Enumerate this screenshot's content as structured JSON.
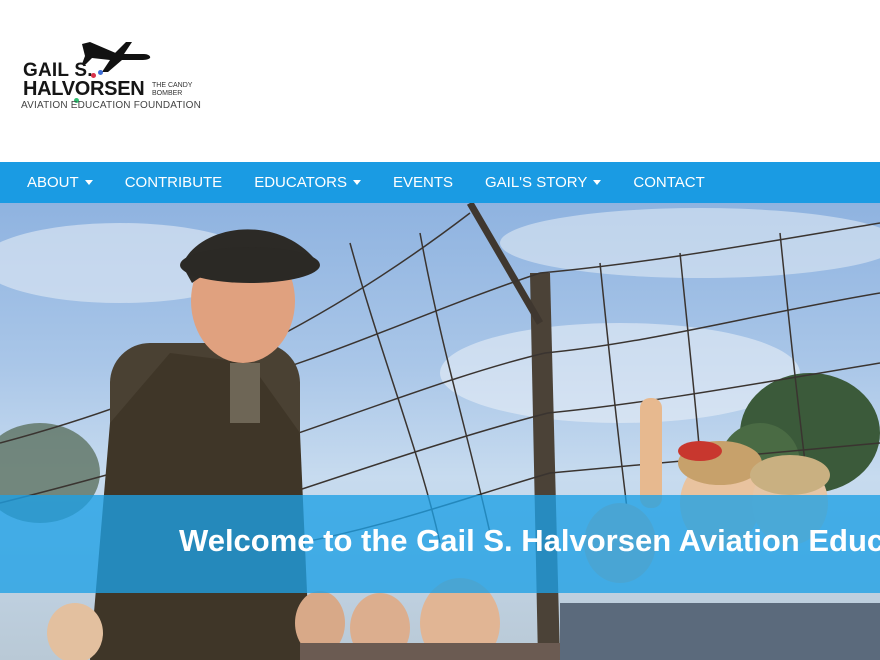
{
  "logo": {
    "line1": "GAIL S.",
    "line2": "HALVORSEN",
    "tagline": "THE CANDY BOMBER",
    "foundation": "AVIATION EDUCATION FOUNDATION"
  },
  "nav": {
    "items": [
      {
        "label": "ABOUT",
        "has_dropdown": true
      },
      {
        "label": "CONTRIBUTE",
        "has_dropdown": false
      },
      {
        "label": "EDUCATORS",
        "has_dropdown": true
      },
      {
        "label": "EVENTS",
        "has_dropdown": false
      },
      {
        "label": "GAIL'S STORY",
        "has_dropdown": true
      },
      {
        "label": "CONTACT",
        "has_dropdown": false
      }
    ]
  },
  "hero": {
    "title": "Welcome to the Gail S. Halvorsen Aviation Education Foundation",
    "image_icon": "hero-photo-airman-children-fence"
  },
  "colors": {
    "nav_bg": "#1a9be3",
    "band": "#1ea0e6",
    "text_light": "#ffffff"
  }
}
